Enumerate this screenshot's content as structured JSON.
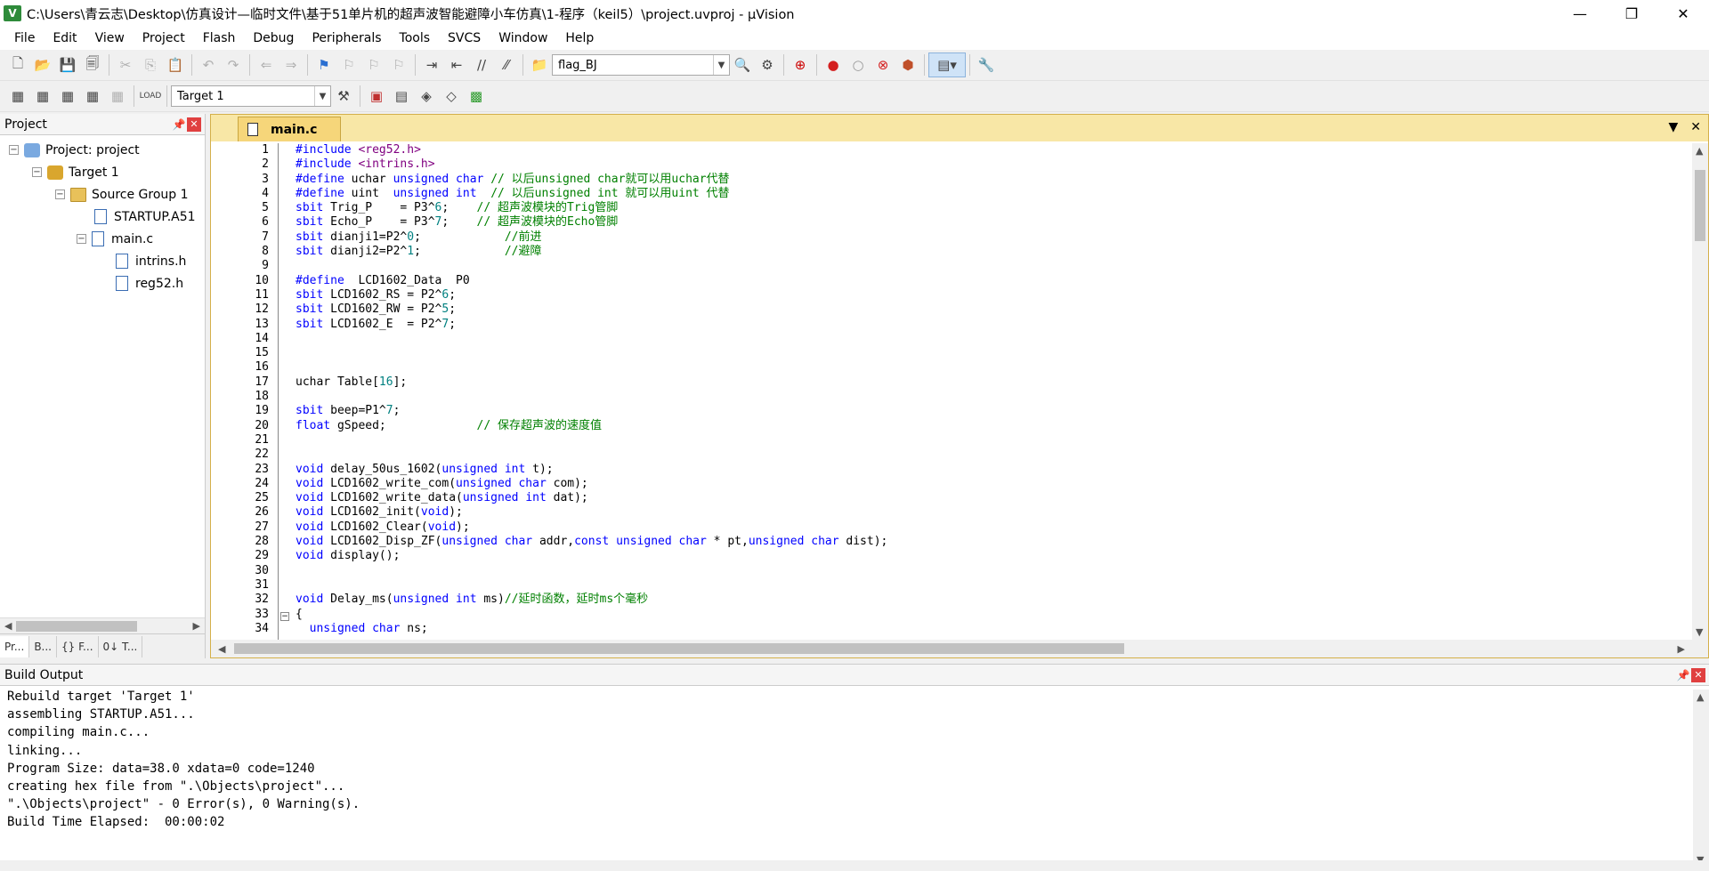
{
  "window": {
    "title": "C:\\Users\\青云志\\Desktop\\仿真设计—临时文件\\基于51单片机的超声波智能避障小车仿真\\1-程序（keil5）\\project.uvproj - µVision"
  },
  "menu": [
    "File",
    "Edit",
    "View",
    "Project",
    "Flash",
    "Debug",
    "Peripherals",
    "Tools",
    "SVCS",
    "Window",
    "Help"
  ],
  "toolbar": {
    "find_value": "flag_BJ",
    "target_value": "Target 1"
  },
  "project_pane": {
    "title": "Project",
    "tree": [
      {
        "label": "Project: project",
        "icon": "project-icon"
      },
      {
        "label": "Target 1",
        "icon": "target-icon"
      },
      {
        "label": "Source Group 1",
        "icon": "folder-icon"
      },
      {
        "label": "STARTUP.A51",
        "icon": "file-icon"
      },
      {
        "label": "main.c",
        "icon": "file-icon"
      },
      {
        "label": "intrins.h",
        "icon": "file-icon"
      },
      {
        "label": "reg52.h",
        "icon": "file-icon"
      }
    ],
    "tabs": [
      "Pr...",
      "B...",
      "{} F...",
      "0↓ T..."
    ]
  },
  "editor": {
    "tab": "main.c",
    "lines": [
      "#include <reg52.h>",
      "#include <intrins.h>",
      "#define uchar unsigned char // 以后unsigned char就可以用uchar代替",
      "#define uint  unsigned int  // 以后unsigned int 就可以用uint 代替",
      "sbit Trig_P    = P3^6;    // 超声波模块的Trig管脚",
      "sbit Echo_P    = P3^7;    // 超声波模块的Echo管脚",
      "sbit dianji1=P2^0;            //前进",
      "sbit dianji2=P2^1;            //避障",
      "",
      "#define  LCD1602_Data  P0",
      "sbit LCD1602_RS = P2^6;",
      "sbit LCD1602_RW = P2^5;",
      "sbit LCD1602_E  = P2^7;",
      "",
      "",
      "",
      "uchar Table[16];",
      "",
      "sbit beep=P1^7;",
      "float gSpeed;             // 保存超声波的速度值",
      "",
      "",
      "void delay_50us_1602(unsigned int t);",
      "void LCD1602_write_com(unsigned char com);",
      "void LCD1602_write_data(unsigned int dat);",
      "void LCD1602_init(void);",
      "void LCD1602_Clear(void);",
      "void LCD1602_Disp_ZF(unsigned char addr,const unsigned char * pt,unsigned char dist);",
      "void display();",
      "",
      "",
      "void Delay_ms(unsigned int ms)//延时函数，延时ms个毫秒",
      "{",
      "  unsigned char ns;"
    ]
  },
  "build_output": {
    "title": "Build Output",
    "lines": [
      "Rebuild target 'Target 1'",
      "assembling STARTUP.A51...",
      "compiling main.c...",
      "linking...",
      "Program Size: data=38.0 xdata=0 code=1240",
      "creating hex file from \".\\Objects\\project\"...",
      "\".\\Objects\\project\" - 0 Error(s), 0 Warning(s).",
      "Build Time Elapsed:  00:00:02"
    ]
  }
}
